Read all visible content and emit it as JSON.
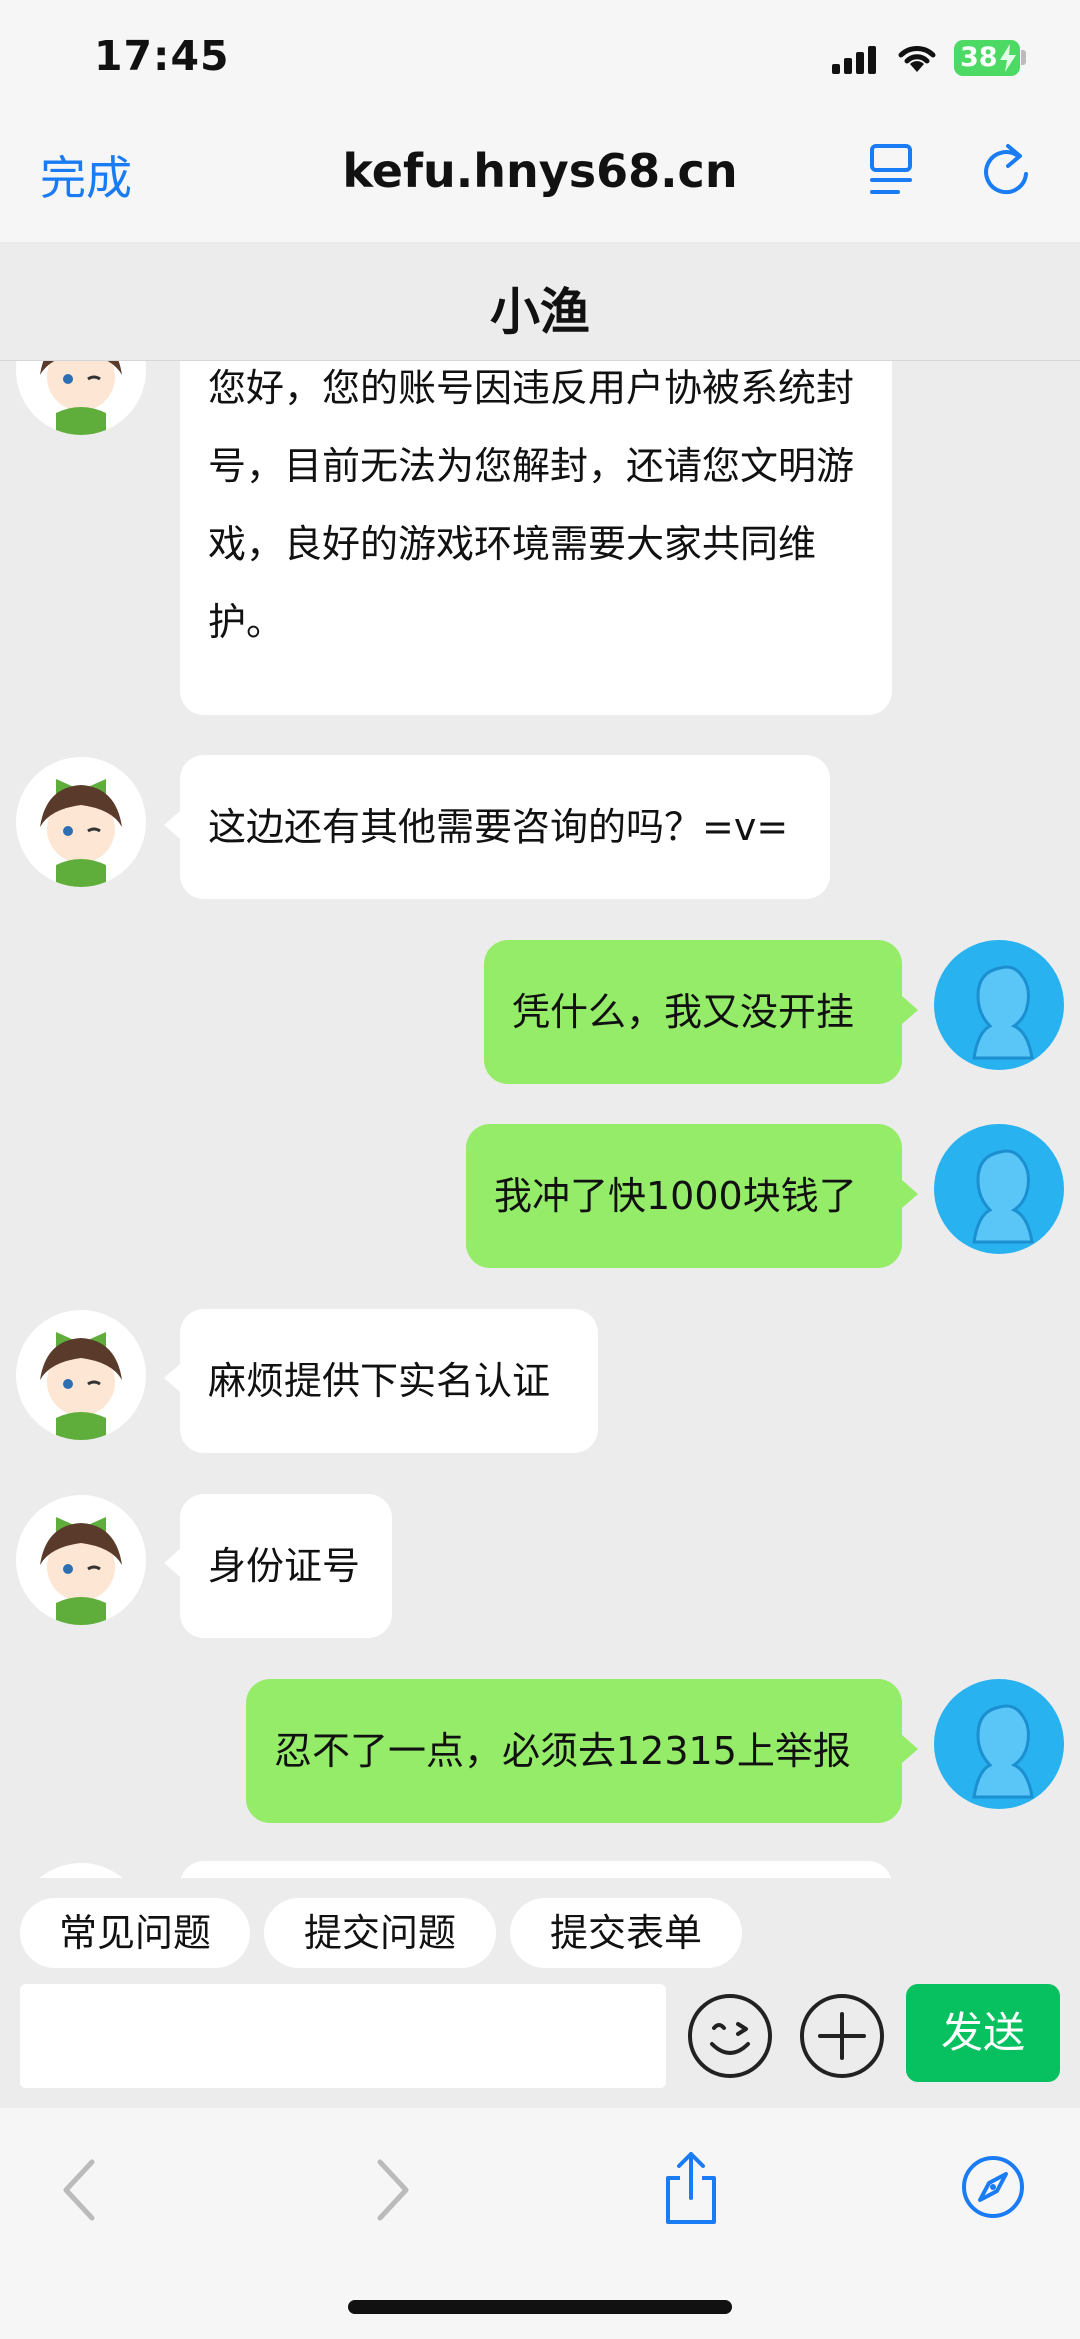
{
  "status_bar": {
    "time": "17:45",
    "battery": "38"
  },
  "browser": {
    "done_label": "完成",
    "url": "kefu.hnys68.cn"
  },
  "chat": {
    "title": "小渔"
  },
  "messages": [
    {
      "sender": "agent",
      "text": "您好，您的账号因违反用户协被系统封号，目前无法为您解封，还请您文明游戏，良好的游戏环境需要大家共同维护。"
    },
    {
      "sender": "agent",
      "text": "这边还有其他需要咨询的吗？=v="
    },
    {
      "sender": "user",
      "text": "凭什么，我又没开挂"
    },
    {
      "sender": "user",
      "text": "我冲了快1000块钱了"
    },
    {
      "sender": "agent",
      "text": "麻烦提供下实名认证"
    },
    {
      "sender": "agent",
      "text": "身份证号"
    },
    {
      "sender": "user",
      "text": "忍不了一点，必须去12315上举报"
    }
  ],
  "quick_actions": [
    "常见问题",
    "提交问题",
    "提交表单"
  ],
  "composer": {
    "placeholder": "",
    "send_label": "发送"
  },
  "colors": {
    "accent": "#1a7cf5",
    "user_bubble": "#95ec69",
    "send": "#07c160",
    "user_avatar": "#29b2f0"
  },
  "icons": [
    "signal-icon",
    "wifi-icon",
    "battery-icon",
    "reader-icon",
    "reload-icon",
    "emoji-icon",
    "plus-icon",
    "back-icon",
    "forward-icon",
    "share-icon",
    "compass-icon"
  ]
}
